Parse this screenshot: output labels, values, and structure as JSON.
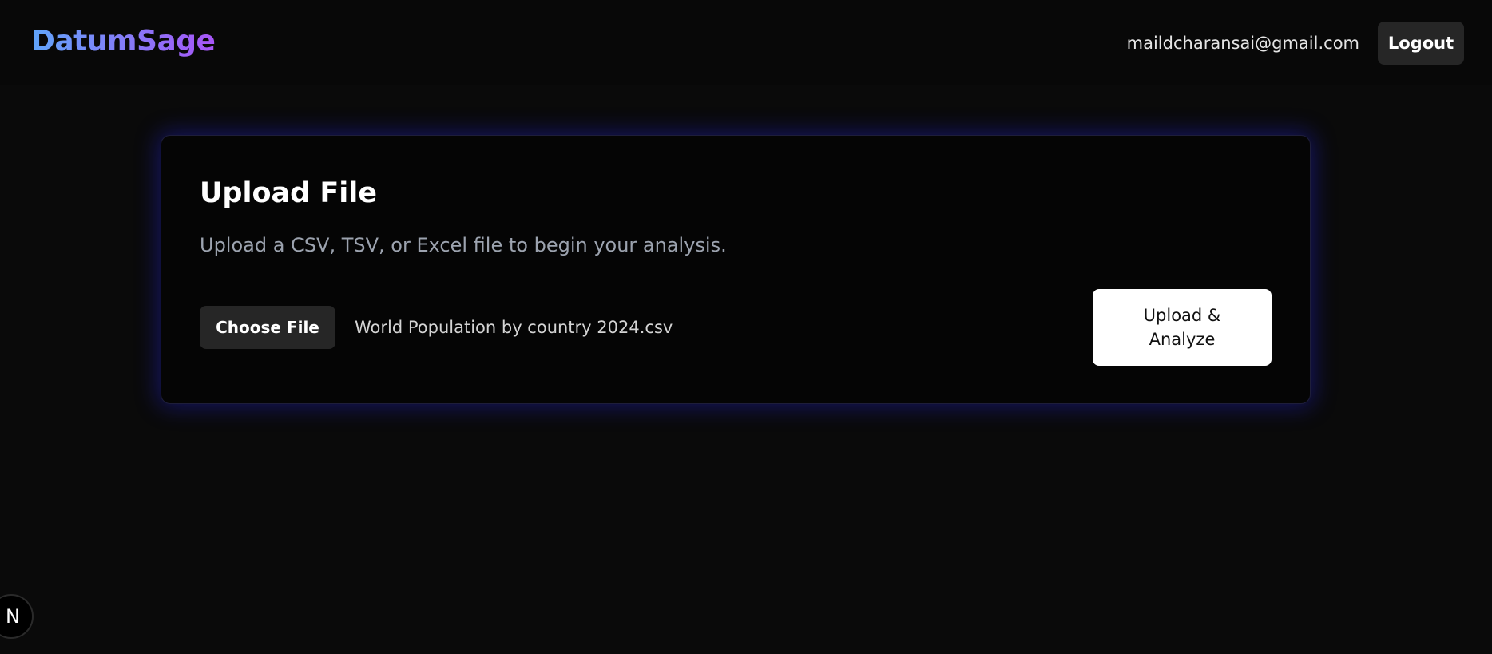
{
  "header": {
    "logo": "DatumSage",
    "user_email": "maildcharansai@gmail.com",
    "logout_label": "Logout"
  },
  "upload_card": {
    "title": "Upload File",
    "description": "Upload a CSV, TSV, or Excel file to begin your analysis.",
    "choose_file_label": "Choose File",
    "selected_file": "World Population by country 2024.csv",
    "upload_button_label": "Upload & Analyze"
  },
  "dev_badge": {
    "letter": "N"
  },
  "colors": {
    "background": "#0a0a0a",
    "logo_gradient_start": "#60a5fa",
    "logo_gradient_end": "#a855f7",
    "card_glow": "#2828ff",
    "button_dark": "#262626",
    "button_light": "#ffffff"
  }
}
